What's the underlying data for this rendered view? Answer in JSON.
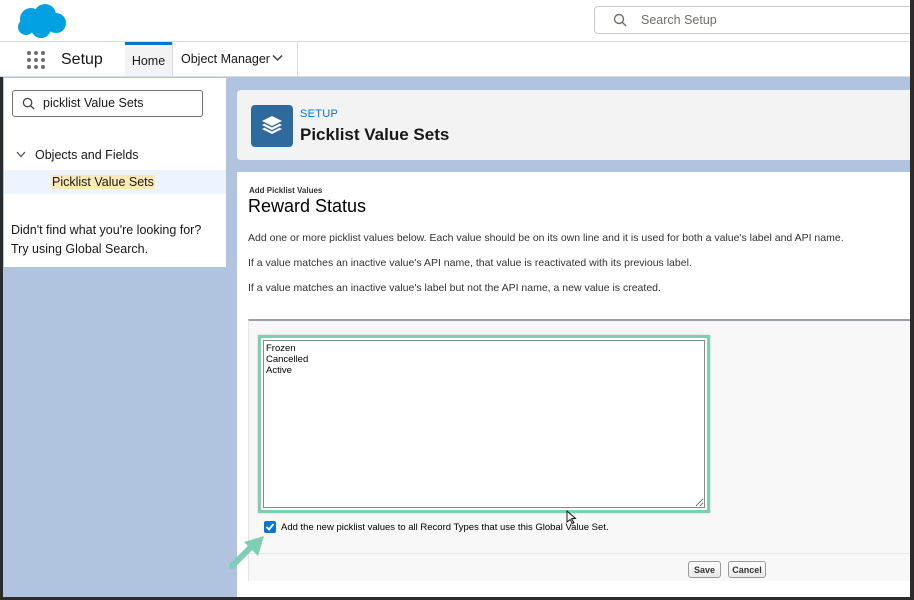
{
  "header": {
    "search_placeholder": "Search Setup"
  },
  "nav": {
    "app_name": "Setup",
    "tabs": [
      {
        "label": "Home",
        "active": true
      },
      {
        "label": "Object Manager",
        "active": false
      }
    ]
  },
  "sidebar": {
    "quick_find_value": "picklist Value Sets",
    "section_label": "Objects and Fields",
    "item_label": "Picklist Value Sets",
    "not_found_text": "Didn't find what you're looking for? Try using Global Search."
  },
  "page_header": {
    "eyebrow": "SETUP",
    "title": "Picklist Value Sets",
    "icon": "layers-icon"
  },
  "form": {
    "eyebrow": "Add Picklist Values",
    "title": "Reward Status",
    "paragraphs": [
      "Add one or more picklist values below. Each value should be on its own line and it is used for both a value's label and API name.",
      "If a value matches an inactive value's API name, that value is reactivated with its previous label.",
      "If a value matches an inactive value's label but not the API name, a new value is created."
    ],
    "values_text": "Frozen\nCancelled\nActive",
    "checkbox_checked": true,
    "checkbox_label": "Add the new picklist values to all Record Types that use this Global Value Set.",
    "save_label": "Save",
    "cancel_label": "Cancel"
  },
  "colors": {
    "brand_blue": "#00a1e0",
    "accent_blue": "#0176d3",
    "highlight_teal": "#7ecdb5",
    "background": "#b0c4df"
  }
}
